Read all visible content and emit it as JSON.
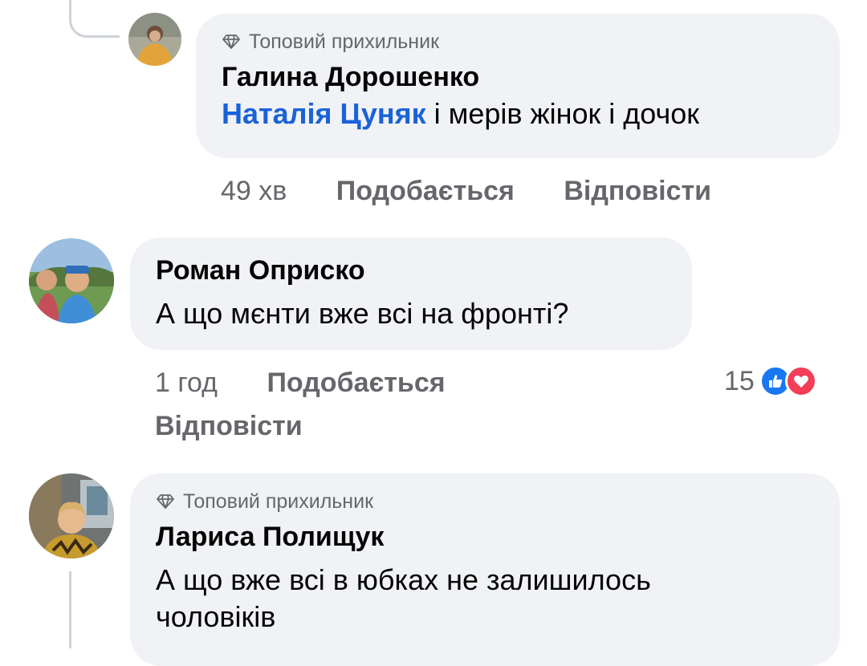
{
  "comments": [
    {
      "badge": "Топовий прихильник",
      "author": "Галина Дорошенко",
      "mention": "Наталія Цуняк",
      "text": " і мерів жінок і дочок",
      "time": "49 хв",
      "like_label": "Подобається",
      "reply_label": "Відповісти"
    },
    {
      "author": "Роман Оприско",
      "text": "А що мєнти вже всі на фронті?",
      "time": "1 год",
      "like_label": "Подобається",
      "reply_label": "Відповісти",
      "reaction_count": "15",
      "reactions": [
        "like-icon",
        "love-icon"
      ]
    },
    {
      "badge": "Топовий прихильник",
      "author": "Лариса Полищук",
      "text_line1": "А що вже всі в юбках не залишилось",
      "text_line2": "чоловіків"
    }
  ],
  "colors": {
    "bubble": "#f0f2f5",
    "mention": "#1a62d8",
    "meta": "#65676b",
    "like": "#1877f2",
    "love": "#f33e58"
  }
}
